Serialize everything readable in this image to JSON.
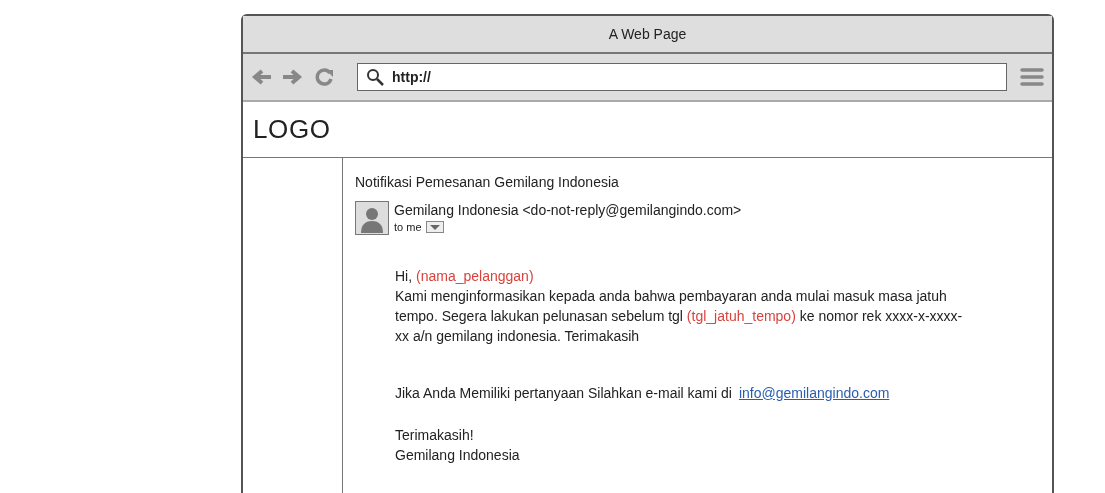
{
  "window": {
    "title": "A Web Page"
  },
  "address_bar": {
    "value": "http://"
  },
  "logo": "LOGO",
  "email": {
    "subject": "Notifikasi Pemesanan Gemilang Indonesia",
    "sender": "Gemilang Indonesia <do-not-reply@gemilangindo.com>",
    "recipient": "to me",
    "greeting": [
      {
        "kind": "text",
        "text": "Hi,"
      },
      {
        "kind": "placeholder",
        "text": "(nama_pelanggan)"
      }
    ],
    "message": [
      {
        "kind": "text",
        "text": "Kami menginformasikan kepada anda bahwa pembayaran anda mulai masuk masa jatuh tempo. Segera lakukan pelunasan sebelum tgl"
      },
      {
        "kind": "placeholder",
        "text": "(tgl_jatuh_tempo)"
      },
      {
        "kind": "text",
        "text": "ke nomor rek xxxx-x-xxxx-xx a/n gemilang indonesia. Terimakasih"
      }
    ],
    "contact_text": "Jika Anda Memiliki pertanyaan Silahkan e-mail kami di",
    "contact_link": "info@gemilangindo.com",
    "closing": "Terimakasih!",
    "signature": "Gemilang Indonesia"
  }
}
